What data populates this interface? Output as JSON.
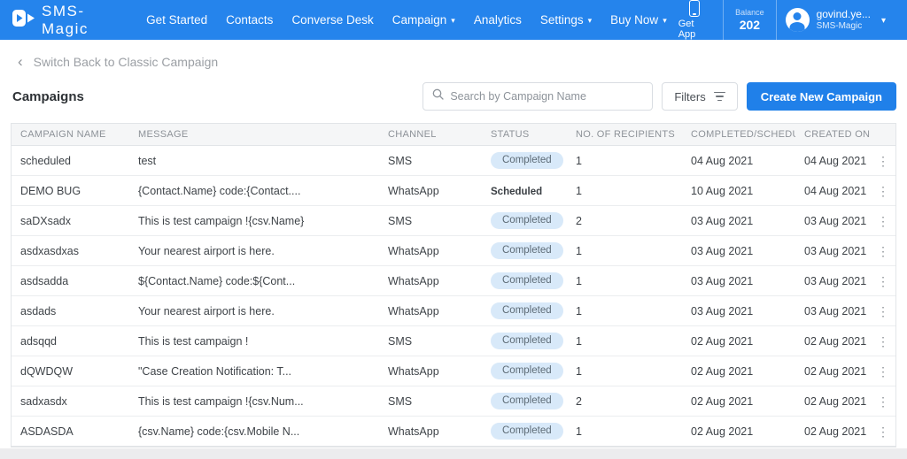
{
  "navbar": {
    "brand": "SMS-Magic",
    "items": [
      {
        "label": "Get Started",
        "dropdown": false
      },
      {
        "label": "Contacts",
        "dropdown": false
      },
      {
        "label": "Converse Desk",
        "dropdown": false
      },
      {
        "label": "Campaign",
        "dropdown": true
      },
      {
        "label": "Analytics",
        "dropdown": false
      },
      {
        "label": "Settings",
        "dropdown": true
      },
      {
        "label": "Buy Now",
        "dropdown": true
      }
    ],
    "get_app_label": "Get App",
    "balance_label": "Balance",
    "balance_value": "202",
    "user_name": "govind.ye...",
    "user_org": "SMS-Magic"
  },
  "breadcrumb": {
    "label": "Switch Back to Classic Campaign"
  },
  "toolbar": {
    "page_title": "Campaigns",
    "search_placeholder": "Search by Campaign Name",
    "filters_label": "Filters",
    "create_button_label": "Create New Campaign"
  },
  "table": {
    "columns": [
      "CAMPAIGN NAME",
      "MESSAGE",
      "CHANNEL",
      "STATUS",
      "NO. OF RECIPIENTS",
      "COMPLETED/SCHEDULED",
      "CREATED ON"
    ],
    "rows": [
      {
        "name": "scheduled",
        "message": "test",
        "channel": "SMS",
        "status": "Completed",
        "recipients": "1",
        "completed_scheduled": "04 Aug 2021",
        "created_on": "04 Aug 2021"
      },
      {
        "name": "DEMO BUG",
        "message": "{Contact.Name} code:{Contact....",
        "channel": "WhatsApp",
        "status": "Scheduled",
        "recipients": "1",
        "completed_scheduled": "10 Aug 2021",
        "created_on": "04 Aug 2021"
      },
      {
        "name": "saDXsadx",
        "message": "This is test campaign !{csv.Name}",
        "channel": "SMS",
        "status": "Completed",
        "recipients": "2",
        "completed_scheduled": "03 Aug 2021",
        "created_on": "03 Aug 2021"
      },
      {
        "name": "asdxasdxas",
        "message": "Your nearest airport is here.",
        "channel": "WhatsApp",
        "status": "Completed",
        "recipients": "1",
        "completed_scheduled": "03 Aug 2021",
        "created_on": "03 Aug 2021"
      },
      {
        "name": "asdsadda",
        "message": "${Contact.Name} code:${Cont...",
        "channel": "WhatsApp",
        "status": "Completed",
        "recipients": "1",
        "completed_scheduled": "03 Aug 2021",
        "created_on": "03 Aug 2021"
      },
      {
        "name": "asdads",
        "message": "Your nearest airport is here.",
        "channel": "WhatsApp",
        "status": "Completed",
        "recipients": "1",
        "completed_scheduled": "03 Aug 2021",
        "created_on": "03 Aug 2021"
      },
      {
        "name": "adsqqd",
        "message": "This is test campaign !",
        "channel": "SMS",
        "status": "Completed",
        "recipients": "1",
        "completed_scheduled": "02 Aug 2021",
        "created_on": "02 Aug 2021"
      },
      {
        "name": "dQWDQW",
        "message": "\"Case Creation Notification: T...",
        "channel": "WhatsApp",
        "status": "Completed",
        "recipients": "1",
        "completed_scheduled": "02 Aug 2021",
        "created_on": "02 Aug 2021"
      },
      {
        "name": "sadxasdx",
        "message": "This is test campaign !{csv.Num...",
        "channel": "SMS",
        "status": "Completed",
        "recipients": "2",
        "completed_scheduled": "02 Aug 2021",
        "created_on": "02 Aug 2021"
      },
      {
        "name": "ASDASDA",
        "message": "{csv.Name} code:{csv.Mobile N...",
        "channel": "WhatsApp",
        "status": "Completed",
        "recipients": "1",
        "completed_scheduled": "02 Aug 2021",
        "created_on": "02 Aug 2021"
      }
    ]
  },
  "colors": {
    "navbar_blue": "#2584ec",
    "button_blue": "#2080e9",
    "completed_pill_bg": "#d8e9f9",
    "completed_pill_text": "#5d6b76"
  }
}
